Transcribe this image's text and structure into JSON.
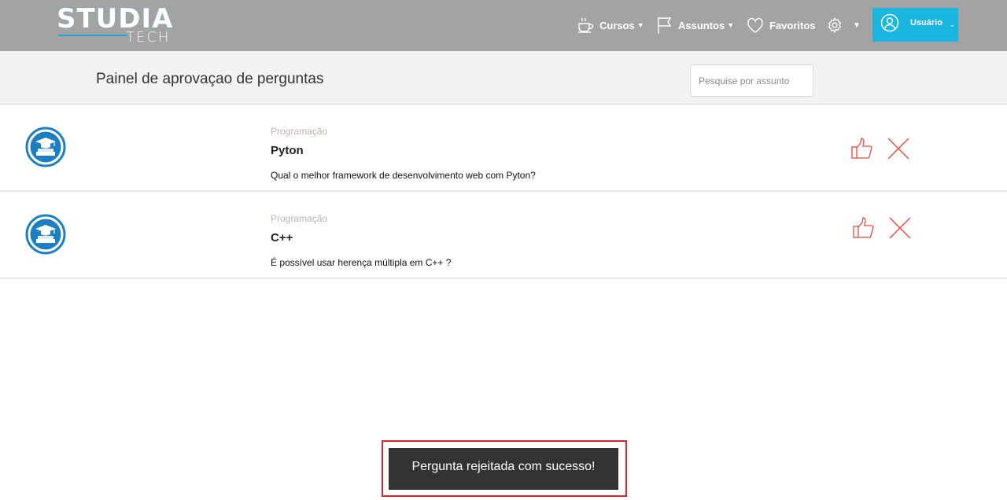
{
  "header": {
    "logo_main": "STUDIA",
    "logo_sub": "TECH",
    "nav": {
      "cursos": "Cursos",
      "assuntos": "Assuntos",
      "favoritos": "Favoritos"
    },
    "user_label": "Usuário",
    "accent_color": "#19b6df",
    "topbar_color": "#a3a3a3"
  },
  "page": {
    "title": "Painel de aprovaçao de perguntas",
    "search_placeholder": "Pesquise por assunto"
  },
  "questions": [
    {
      "category": "Programação",
      "title": "Pyton",
      "text": "Qual o melhor framework de desenvolvimento web com Pyton?"
    },
    {
      "category": "Programação",
      "title": "C++",
      "text": "É possível usar herença múltipla em C++ ?"
    }
  ],
  "toast": {
    "message": "Pergunta rejeitada com sucesso!",
    "highlight_color": "#d9232d"
  },
  "icons": {
    "question": "graduation-cap-icon",
    "approve": "thumbs-up-icon",
    "reject": "close-icon"
  }
}
